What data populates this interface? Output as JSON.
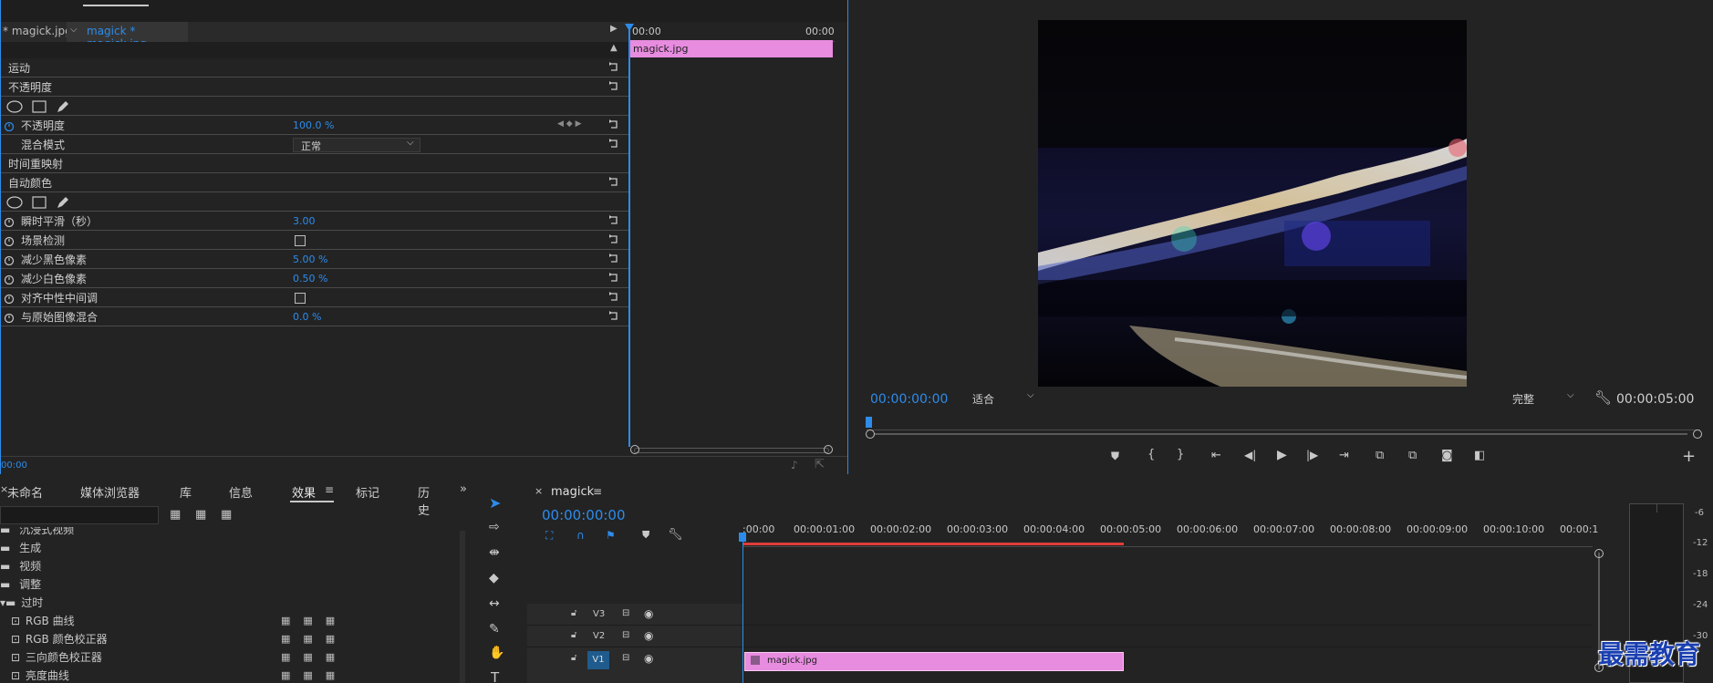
{
  "effect_controls": {
    "tab_source": "* magick.jpg",
    "tab_active": "magick * magick.jpg",
    "timeline_start": "00:00",
    "timeline_end": "00:00",
    "clip_label": "magick.jpg",
    "bottom_timecode": "00:00",
    "rows": {
      "motion": "运动",
      "opacity_group": "不透明度",
      "opacity": "不透明度",
      "opacity_value": "100.0 %",
      "blend_mode": "混合模式",
      "blend_value": "正常",
      "time_remap": "时间重映射",
      "auto_color": "自动颜色",
      "temporal_smoothing": "瞬时平滑（秒）",
      "temporal_value": "3.00",
      "scene_detect": "场景检测",
      "black_clip": "减少黑色像素",
      "black_value": "5.00 %",
      "white_clip": "减少白色像素",
      "white_value": "0.50 %",
      "snap_neutral": "对齐中性中间调",
      "blend_original": "与原始图像混合",
      "blend_original_value": "0.0 %"
    }
  },
  "program_monitor": {
    "timecode_current": "00:00:00:00",
    "fit_value": "适合",
    "quality_value": "完整",
    "timecode_duration": "00:00:05:00"
  },
  "project_panel": {
    "tabs": [
      "未命名",
      "媒体浏览器",
      "库",
      "信息",
      "效果",
      "标记",
      "历史"
    ],
    "active_tab": "效果",
    "tree": [
      "沉浸式视频",
      "生成",
      "视频",
      "调整",
      "过时"
    ],
    "effects": [
      "RGB 曲线",
      "RGB 颜色校正器",
      "三向颜色校正器",
      "亮度曲线"
    ]
  },
  "timeline": {
    "sequence_name": "magick",
    "timecode": "00:00:00:00",
    "ruler": [
      ":00:00",
      "00:00:01:00",
      "00:00:02:00",
      "00:00:03:00",
      "00:00:04:00",
      "00:00:05:00",
      "00:00:06:00",
      "00:00:07:00",
      "00:00:08:00",
      "00:00:09:00",
      "00:00:10:00",
      "00:00:1"
    ],
    "tracks": [
      "V3",
      "V2",
      "V1"
    ],
    "clip_label": "magick.jpg"
  },
  "audio_meter": {
    "labels": [
      "-6",
      "-12",
      "-18",
      "-24",
      "-30"
    ]
  },
  "watermark": "最需教育",
  "colors": {
    "accent_blue": "#2d8ceb",
    "clip_pink": "#e88ce0",
    "panel_bg": "#232323",
    "header_bg": "#1e1e1e"
  }
}
